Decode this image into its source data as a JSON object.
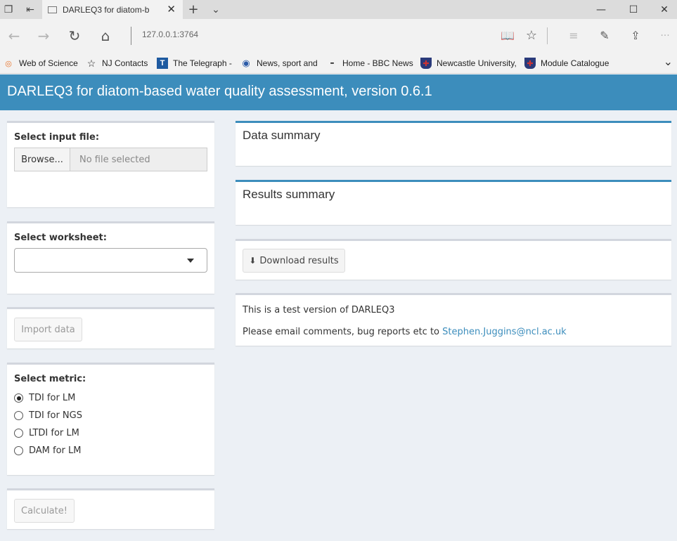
{
  "browser": {
    "tab_title": "DARLEQ3 for diatom-b",
    "address": "127.0.0.1:3764",
    "favorites": [
      {
        "label": "Web of Science",
        "icon": "orange-circle-icon"
      },
      {
        "label": "NJ Contacts",
        "icon": "star-icon"
      },
      {
        "label": "The Telegraph -",
        "icon": "telegraph-icon"
      },
      {
        "label": "News, sport and",
        "icon": "globe-person-icon"
      },
      {
        "label": "Home - BBC News",
        "icon": "bbc-icon"
      },
      {
        "label": "Newcastle University,",
        "icon": "ncl-shield-icon"
      },
      {
        "label": "Module Catalogue",
        "icon": "ncl-shield-icon"
      }
    ]
  },
  "app": {
    "title": "DARLEQ3 for diatom-based water quality assessment, version 0.6.1",
    "accent_color": "#3c8dbc"
  },
  "sidebar": {
    "input_file_label": "Select input file:",
    "browse_label": "Browse...",
    "file_placeholder": "No file selected",
    "worksheet_label": "Select worksheet:",
    "worksheet_value": "",
    "import_label": "Import data",
    "metric_label": "Select metric:",
    "metrics": [
      {
        "label": "TDI for LM",
        "selected": true
      },
      {
        "label": "TDI for NGS",
        "selected": false
      },
      {
        "label": "LTDI for LM",
        "selected": false
      },
      {
        "label": "DAM for LM",
        "selected": false
      }
    ],
    "calculate_label": "Calculate!"
  },
  "main": {
    "data_summary_title": "Data summary",
    "results_summary_title": "Results summary",
    "download_label": "Download results",
    "info_line1": "This is a test version of DARLEQ3",
    "info_line2_prefix": "Please email comments, bug reports etc to ",
    "info_email": "Stephen.Juggins@ncl.ac.uk"
  }
}
